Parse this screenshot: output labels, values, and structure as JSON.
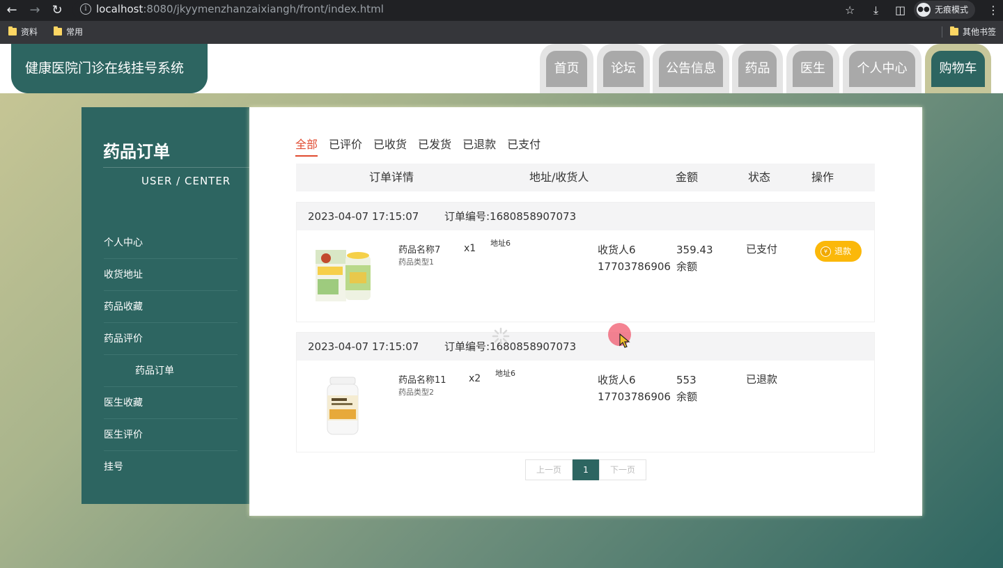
{
  "browser": {
    "url_host": "localhost",
    "url_rest": ":8080/jkyymenzhanzaixiangh/front/index.html",
    "incognito_label": "无痕模式",
    "bookmarks": [
      "资料",
      "常用"
    ],
    "other_bookmarks": "其他书签"
  },
  "header": {
    "logo": "健康医院门诊在线挂号系统",
    "nav": [
      "首页",
      "论坛",
      "公告信息",
      "药品",
      "医生",
      "个人中心",
      "购物车"
    ],
    "active_nav": "购物车"
  },
  "sidebar": {
    "title": "药品订单",
    "subtitle": "USER / CENTER",
    "items": [
      "个人中心",
      "收货地址",
      "药品收藏",
      "药品评价",
      "药品订单",
      "医生收藏",
      "医生评价",
      "挂号"
    ],
    "active_item": "药品订单"
  },
  "filter_tabs": [
    "全部",
    "已评价",
    "已收货",
    "已发货",
    "已退款",
    "已支付"
  ],
  "active_filter": "全部",
  "table_header": {
    "detail": "订单详情",
    "address": "地址/收货人",
    "amount": "金额",
    "status": "状态",
    "action": "操作"
  },
  "orders": [
    {
      "date": "2023-04-07 17:15:07",
      "order_no": "订单编号:1680858907073",
      "product_name": "药品名称7",
      "product_type": "药品类型1",
      "quantity": "x1",
      "address": "地址6",
      "receiver": "收货人6",
      "phone": "17703786906",
      "amount": "359.43",
      "pay_method": "余额",
      "status": "已支付",
      "action": "退款"
    },
    {
      "date": "2023-04-07 17:15:07",
      "order_no": "订单编号:1680858907073",
      "product_name": "药品名称11",
      "product_type": "药品类型2",
      "quantity": "x2",
      "address": "地址6",
      "receiver": "收货人6",
      "phone": "17703786906",
      "amount": "553",
      "pay_method": "余额",
      "status": "已退款",
      "action": ""
    }
  ],
  "pagination": {
    "prev": "上一页",
    "current": "1",
    "next": "下一页"
  },
  "colors": {
    "primary": "#2d6561",
    "accent": "#e04a2f",
    "refund": "#fbb80a"
  }
}
